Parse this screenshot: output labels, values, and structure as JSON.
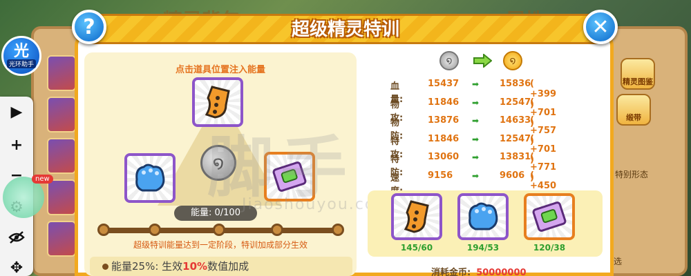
{
  "background": {
    "left_title": "精灵背包",
    "right_title": "属性",
    "side_buttons": [
      "精灵图鉴",
      "缎带"
    ],
    "side_texts": [
      "特别形态",
      "选"
    ]
  },
  "assistant": {
    "logo_char": "光",
    "logo_name": "光环助手",
    "new_badge": "new",
    "tools": [
      "play-icon",
      "plus-icon",
      "minus-icon",
      "gear-icon",
      "eye-off-icon",
      "move-icon"
    ]
  },
  "dialog": {
    "title": "超级精灵特训",
    "help_label": "?",
    "close_label": "✕",
    "hint": "点击道具位置注入能量",
    "energy_label": "能量: 0/100",
    "energy_progress": 0,
    "energy_note": "超级特训能量达到一定阶段，特训加成部分生效",
    "bonus": {
      "prefix": "能量25%: 生效",
      "percent": "10%",
      "suffix": "数值加成"
    }
  },
  "stats": [
    {
      "name": "血量:",
      "old": "15437",
      "new": "15836",
      "bonus": "( +399 )"
    },
    {
      "name": "物攻:",
      "old": "11846",
      "new": "12547",
      "bonus": "( +701 )"
    },
    {
      "name": "物防:",
      "old": "13876",
      "new": "14633",
      "bonus": "( +757 )"
    },
    {
      "name": "特攻:",
      "old": "11846",
      "new": "12547",
      "bonus": "( +701 )"
    },
    {
      "name": "特防:",
      "old": "13060",
      "new": "13831",
      "bonus": "( +771 )"
    },
    {
      "name": "速度:",
      "old": "9156",
      "new": "9606",
      "bonus": "( +450 )"
    }
  ],
  "stat_arrow": "➡",
  "materials": [
    {
      "icon": "orange-talisman-icon",
      "count": "145/60"
    },
    {
      "icon": "blue-paw-glove-icon",
      "count": "194/53"
    },
    {
      "icon": "green-chip-card-icon",
      "count": "120/38"
    }
  ],
  "cost": {
    "label": "消耗金币:",
    "value": "50000000"
  },
  "watermark": {
    "main": "脚手",
    "sub": "Jiaoshouyou.com"
  }
}
